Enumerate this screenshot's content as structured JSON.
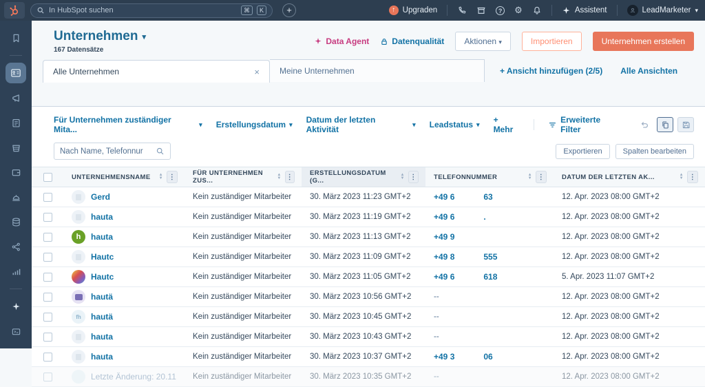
{
  "topbar": {
    "search_placeholder": "In HubSpot suchen",
    "shortcut_cmd": "⌘",
    "shortcut_k": "K",
    "plus_label": "+",
    "upgrade_label": "Upgraden",
    "assistant_label": "Assistent",
    "user_name": "LeadMarketer",
    "icons": [
      "hubspot-logo",
      "search",
      "phone",
      "marketplace",
      "help",
      "gear",
      "bell",
      "sparkle",
      "avatar",
      "caret-down"
    ]
  },
  "sidebar": {
    "icons": [
      "bookmark",
      "contact-card",
      "megaphone",
      "clipboard",
      "basket",
      "wallet",
      "bell-dome",
      "database",
      "share-nodes",
      "bar-chart",
      "sparkle",
      "badge"
    ],
    "active_item": "contact-card"
  },
  "header": {
    "title": "Unternehmen",
    "record_count": "167 Datensätze",
    "data_agent_label": "Data Agent",
    "data_quality_label": "Datenqualität",
    "actions_label": "Aktionen",
    "import_label": "Importieren",
    "create_label": "Unternehmen erstellen"
  },
  "views": {
    "tabs": [
      "Alle Unternehmen",
      "Meine Unternehmen"
    ],
    "close_glyph": "×",
    "add_view_label": "+ Ansicht hinzufügen (2/5)",
    "all_views_label": "Alle Ansichten"
  },
  "filters": {
    "dropdowns": [
      "Für Unternehmen zuständiger Mita...",
      "Erstellungsdatum",
      "Datum der letzten Aktivität",
      "Leadstatus"
    ],
    "more_label": "+ Mehr",
    "advanced_label": "Erweiterte Filter",
    "caret_glyph": "▾"
  },
  "table_toolbar": {
    "search_placeholder": "Nach Name, Telefonnur",
    "export_label": "Exportieren",
    "edit_columns_label": "Spalten bearbeiten"
  },
  "table": {
    "columns": [
      "UNTERNEHMENSNAME",
      "FÜR UNTERNEHMEN ZUS...",
      "ERSTELLUNGSDATUM (G...",
      "TELEFONNUMMER",
      "DATUM DER LETZTEN AK..."
    ],
    "kebab_glyph": "⋮",
    "rows": [
      {
        "name": "Gerd",
        "owner": "Kein zuständiger Mitarbeiter",
        "created": "30. März 2023 11:23 GMT+2",
        "phone_prefix": "+49 6",
        "phone_suffix": "63",
        "last_activity": "12. Apr. 2023 08:00 GMT+2"
      },
      {
        "name": "hauta",
        "owner": "Kein zuständiger Mitarbeiter",
        "created": "30. März 2023 11:19 GMT+2",
        "phone_prefix": "+49 6",
        "phone_suffix": ".",
        "last_activity": "12. Apr. 2023 08:00 GMT+2"
      },
      {
        "name": "hauta",
        "avatar_text": "h",
        "owner": "Kein zuständiger Mitarbeiter",
        "created": "30. März 2023 11:13 GMT+2",
        "phone_prefix": "+49 9",
        "phone_suffix": "",
        "last_activity": "12. Apr. 2023 08:00 GMT+2"
      },
      {
        "name": "Hautc",
        "owner": "Kein zuständiger Mitarbeiter",
        "created": "30. März 2023 11:09 GMT+2",
        "phone_prefix": "+49 8",
        "phone_suffix": "555",
        "last_activity": "12. Apr. 2023 08:00 GMT+2"
      },
      {
        "name": "Hautc",
        "owner": "Kein zuständiger Mitarbeiter",
        "created": "30. März 2023 11:05 GMT+2",
        "phone_prefix": "+49 6",
        "phone_suffix": "618",
        "last_activity": "5. Apr. 2023 11:07 GMT+2"
      },
      {
        "name": "hautä",
        "owner": "Kein zuständiger Mitarbeiter",
        "created": "30. März 2023 10:56 GMT+2",
        "phone_prefix": "--",
        "phone_suffix": "",
        "last_activity": "12. Apr. 2023 08:00 GMT+2"
      },
      {
        "name": "hautä",
        "avatar_text": "fh",
        "owner": "Kein zuständiger Mitarbeiter",
        "created": "30. März 2023 10:45 GMT+2",
        "phone_prefix": "--",
        "phone_suffix": "",
        "last_activity": "12. Apr. 2023 08:00 GMT+2"
      },
      {
        "name": "hauta",
        "owner": "Kein zuständiger Mitarbeiter",
        "created": "30. März 2023 10:43 GMT+2",
        "phone_prefix": "--",
        "phone_suffix": "",
        "last_activity": "12. Apr. 2023 08:00 GMT+2"
      },
      {
        "name": "hauta",
        "owner": "Kein zuständiger Mitarbeiter",
        "created": "30. März 2023 10:37 GMT+2",
        "phone_prefix": "+49 3",
        "phone_suffix": "06",
        "last_activity": "12. Apr. 2023 08:00 GMT+2"
      },
      {
        "name": "Letzte Änderung: 20.11",
        "owner": "Kein zuständiger Mitarbeiter",
        "created": "30. März 2023 10:35 GMT+2",
        "phone_prefix": "--",
        "phone_suffix": "",
        "last_activity": "12. Apr. 2023 08:00 GMT+2"
      }
    ]
  },
  "colors": {
    "navbar": "#2d3e50",
    "accent_orange": "#e8765a",
    "link_teal": "#1272a5",
    "magenta": "#c73b80",
    "page_bg": "#f5f8fa"
  }
}
